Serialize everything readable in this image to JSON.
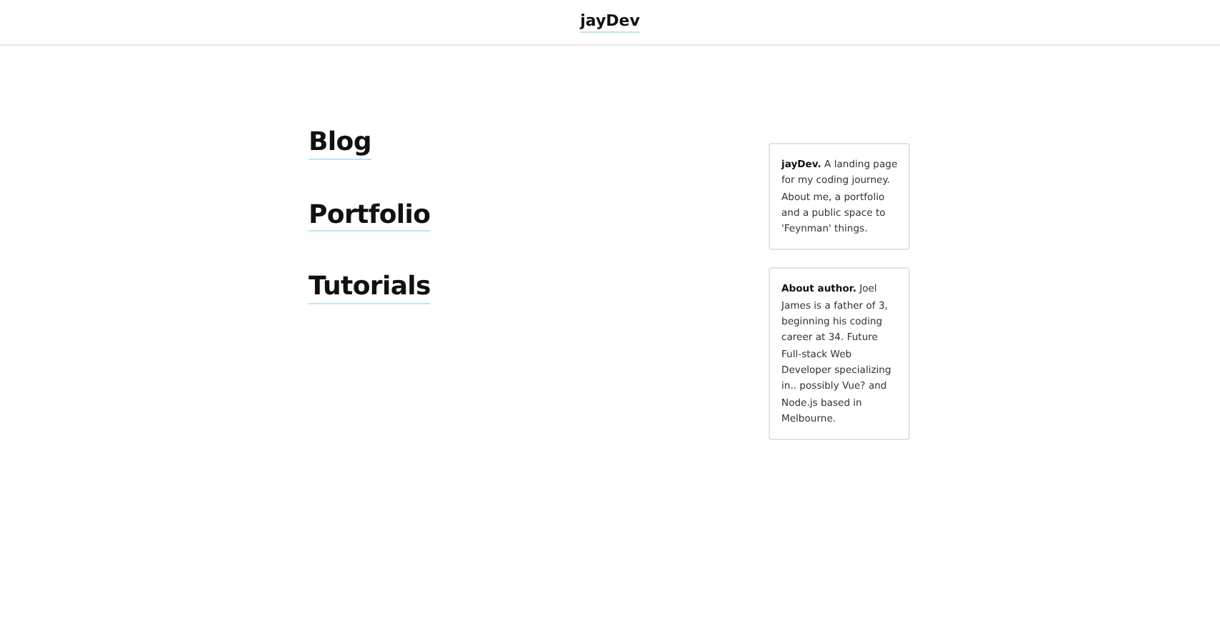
{
  "header": {
    "title": "jayDev"
  },
  "links": [
    "Blog",
    "Portfolio",
    "Tutorials"
  ],
  "cards": [
    "**jayDev.** A landing page for my coding journey. About me, a portfolio and a public space to 'Feynman' things.",
    "**About author.** Joel James is a father of 3, beginning his coding career at 34. Future Full-stack Web Developer specializing in.. possibly Vue? and Node.js based in Melbourne."
  ]
}
